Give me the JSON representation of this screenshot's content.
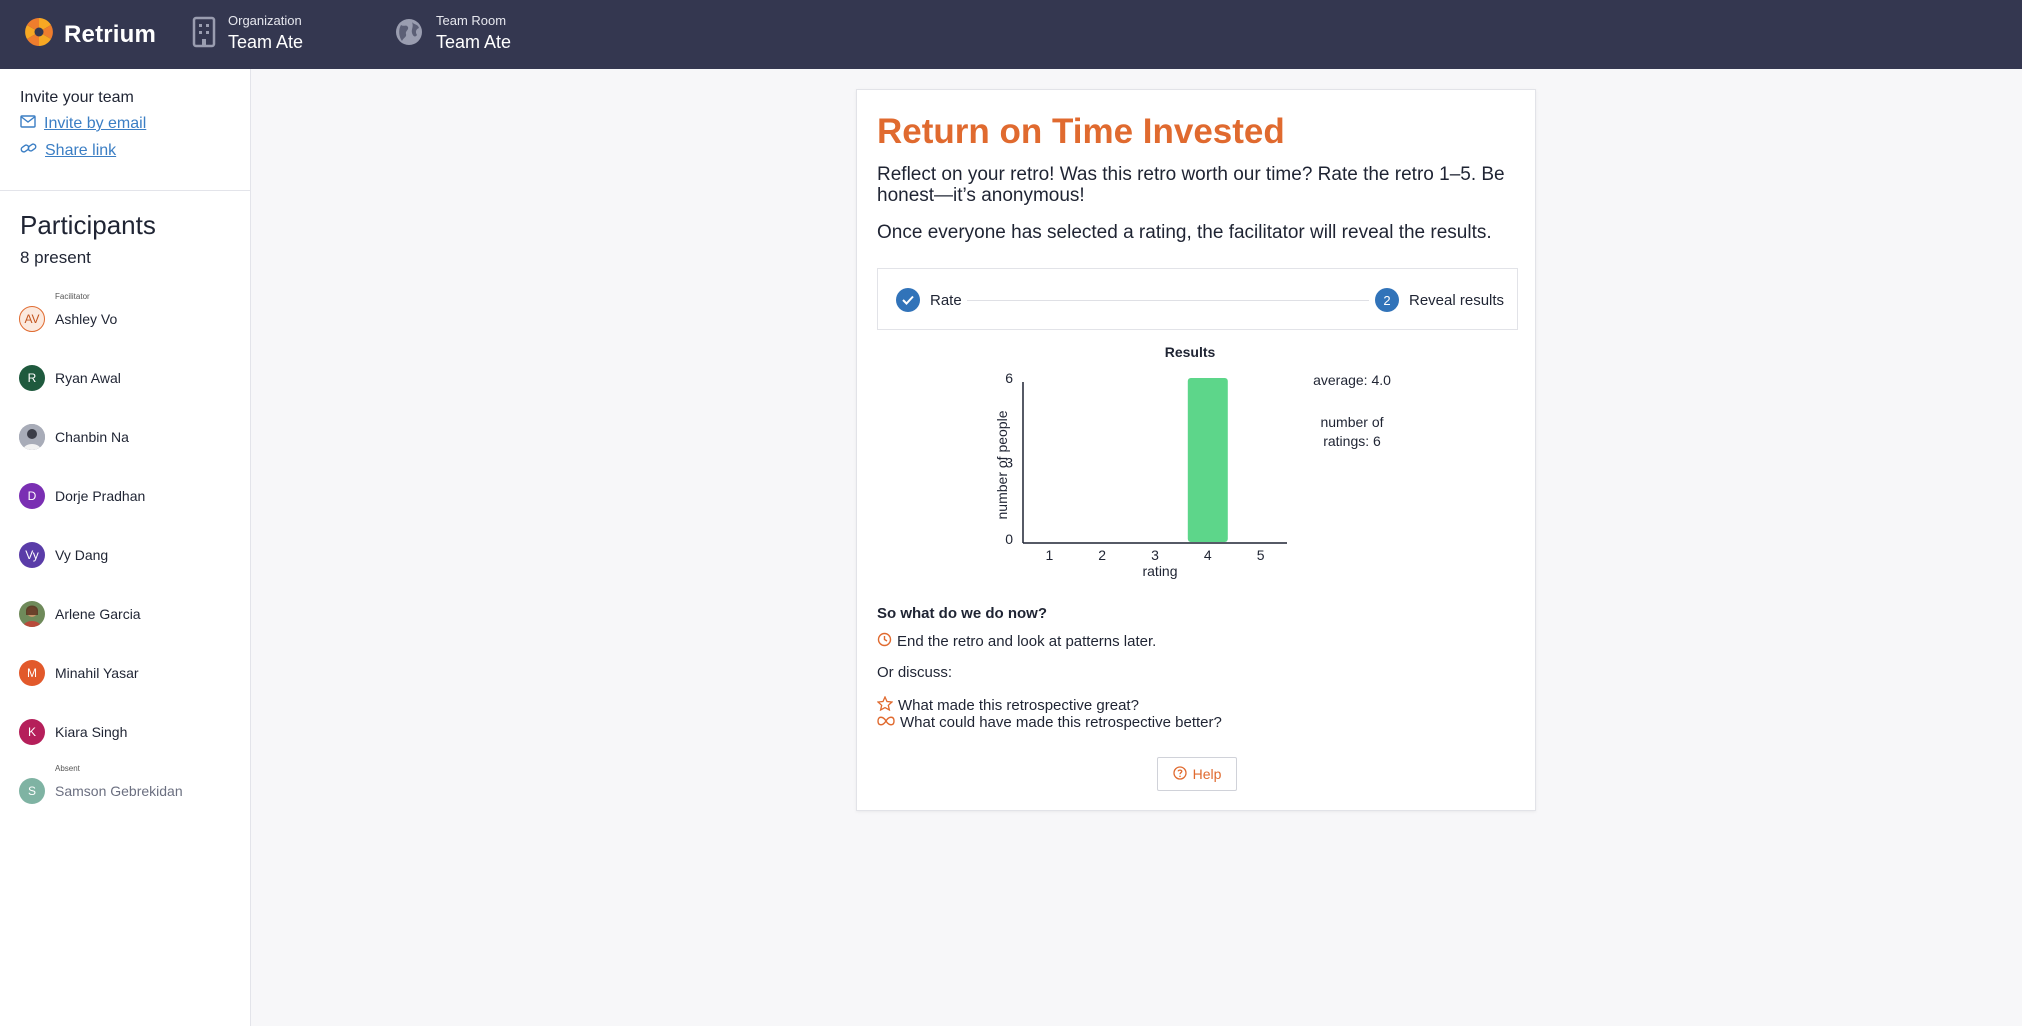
{
  "header": {
    "brand": "Retrium",
    "organization_label": "Organization",
    "organization_name": "Team Ate",
    "room_label": "Team Room",
    "room_name": "Team Ate"
  },
  "sidebar": {
    "invite_title": "Invite your team",
    "invite_email": "Invite by email",
    "share_link": "Share link",
    "participants_title": "Participants",
    "present_count": "8 present",
    "participants": [
      {
        "name": "Ashley Vo",
        "initials": "AV",
        "role": "Facilitator",
        "color": "#fbe9de"
      },
      {
        "name": "Ryan Awal",
        "initials": "R",
        "role": "",
        "color": "#1f5a3e"
      },
      {
        "name": "Chanbin Na",
        "initials": "",
        "role": "",
        "color": "#6b6f80"
      },
      {
        "name": "Dorje Pradhan",
        "initials": "D",
        "role": "",
        "color": "#7a2fb3"
      },
      {
        "name": "Vy Dang",
        "initials": "Vy",
        "role": "",
        "color": "#5a3ca8"
      },
      {
        "name": "Arlene Garcia",
        "initials": "",
        "role": "",
        "color": "#8a6a4a"
      },
      {
        "name": "Minahil Yasar",
        "initials": "M",
        "role": "",
        "color": "#e2592b"
      },
      {
        "name": "Kiara Singh",
        "initials": "K",
        "role": "",
        "color": "#b51f5a"
      },
      {
        "name": "Samson Gebrekidan",
        "initials": "S",
        "role": "Absent",
        "color": "#7fb3a3"
      }
    ]
  },
  "card": {
    "title": "Return on Time Invested",
    "description": "Reflect on your retro! Was this retro worth our time? Rate the retro 1–5. Be honest—it’s anonymous!",
    "description2": "Once everyone has selected a rating, the facilitator will reveal the results.",
    "step1_label": "Rate",
    "step2_number": "2",
    "step2_label": "Reveal results",
    "next_title": "So what do we do now?",
    "end_retro": "End the retro and look at patterns later.",
    "or_discuss": "Or discuss:",
    "discuss_great": "What made this retrospective great?",
    "discuss_better": "What could have made this retrospective better?",
    "help_label": "Help"
  },
  "colors": {
    "accent": "#e06a2f",
    "header_bg": "#343750",
    "step_blue": "#3173b9",
    "bar_green": "#5dd68a"
  },
  "chart_data": {
    "type": "bar",
    "title": "Results",
    "xlabel": "rating",
    "ylabel": "number of people",
    "categories": [
      "1",
      "2",
      "3",
      "4",
      "5"
    ],
    "values": [
      0,
      0,
      0,
      6,
      0
    ],
    "ylim": [
      0,
      6
    ],
    "yticks": [
      0,
      3,
      6
    ],
    "average_text": "average: 4.0",
    "ratings_text_1": "number of",
    "ratings_text_2": "ratings: 6"
  }
}
